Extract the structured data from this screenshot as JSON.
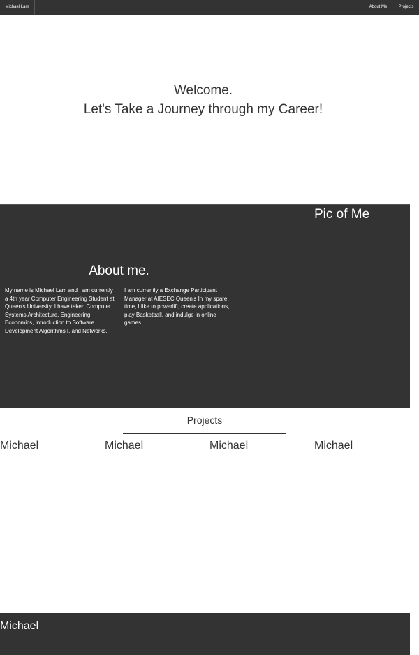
{
  "nav": {
    "brand": "Michael Lam",
    "links": [
      "About Me",
      "Projects"
    ]
  },
  "hero": {
    "line1": "Welcome.",
    "line2": "Let's Take a Journey through my Career!"
  },
  "about": {
    "pic_caption": "Pic of Me",
    "heading": "About me.",
    "col_left": "My name is Michael Lam and I am currently a 4th year Computer Engineering Student at Queen's University. I have taken Computer Systems Architecture, Engineering Economics, Introduction to Software Development Algorithms I, and Networks.",
    "col_right": "I am currently a Exchange Participant Manager at AIESEC Queen's In my spare time, I like to powerlift, create applications, play Basketball, and indulge in online games."
  },
  "projects": {
    "title": "Projects",
    "cards": [
      "Michael",
      "Michael",
      "Michael",
      "Michael"
    ]
  },
  "footer": {
    "name": "Michael"
  },
  "colors": {
    "dark": "#333333",
    "light": "#ffffff"
  }
}
